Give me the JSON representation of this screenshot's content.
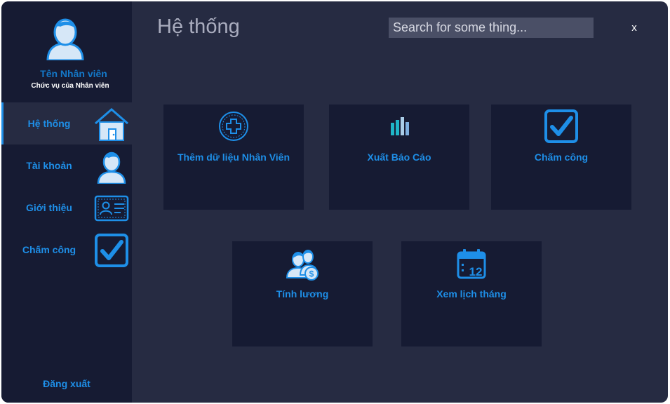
{
  "profile": {
    "name": "Tên Nhân viên",
    "role": "Chức vụ của Nhân viên"
  },
  "sidebar": {
    "items": [
      {
        "label": "Hệ thống",
        "icon": "house-icon",
        "active": true
      },
      {
        "label": "Tài khoản",
        "icon": "user-icon",
        "active": false
      },
      {
        "label": "Giới thiệu",
        "icon": "id-card-icon",
        "active": false
      },
      {
        "label": "Chấm công",
        "icon": "checkbox-icon",
        "active": false
      }
    ],
    "logout_label": "Đăng xuất"
  },
  "header": {
    "title": "Hệ thống",
    "search_placeholder": "Search for some thing...",
    "close_label": "x"
  },
  "tiles": [
    {
      "label": "Thêm dữ liệu Nhân Viên",
      "icon": "add-circle-icon"
    },
    {
      "label": "Xuất Báo Cáo",
      "icon": "bar-chart-icon"
    },
    {
      "label": "Chấm công",
      "icon": "checkbox-icon"
    },
    {
      "label": "Tính lương",
      "icon": "salary-people-icon"
    },
    {
      "label": "Xem lịch tháng",
      "icon": "calendar-icon"
    }
  ],
  "calendar_day": "12",
  "salary_symbol": "$",
  "colors": {
    "background": "#262b42",
    "sidebar": "#161b33",
    "accent": "#1e8fe8",
    "name_text": "#1478c8",
    "title_text": "#a9acbe",
    "search_bg": "#4a4f66"
  }
}
